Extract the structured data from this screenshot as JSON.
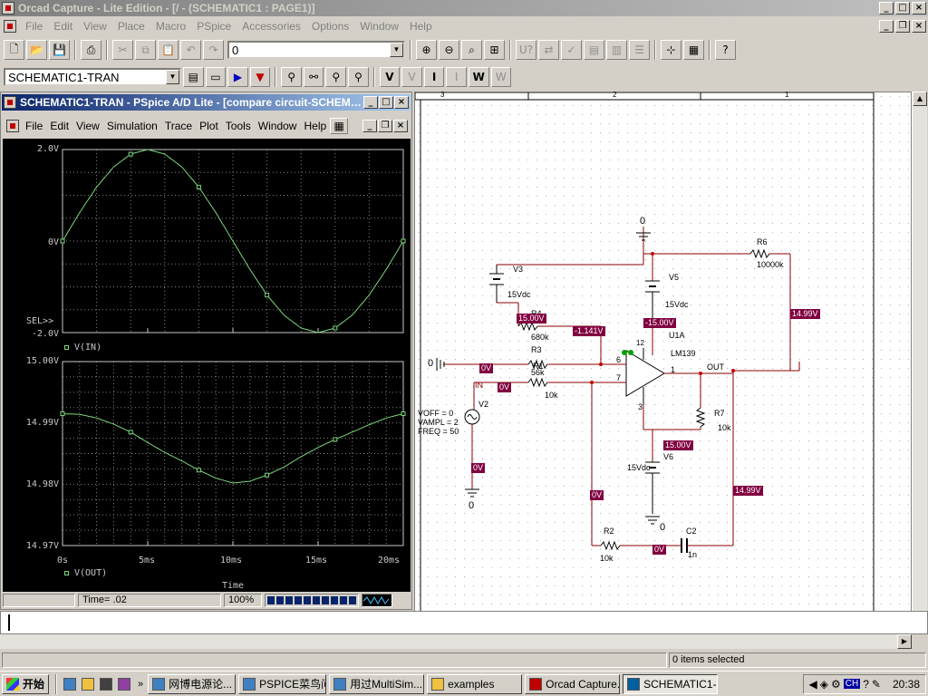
{
  "app": {
    "title": "Orcad Capture - Lite Edition - [/ - (SCHEMATIC1 : PAGE1)]",
    "menu": [
      "File",
      "Edit",
      "View",
      "Place",
      "Macro",
      "PSpice",
      "Accessories",
      "Options",
      "Window",
      "Help"
    ],
    "part_combo_value": "0",
    "profile_combo_value": "SCHEMATIC1-TRAN",
    "status_text": "0 items selected"
  },
  "pspice": {
    "title": "SCHEMATIC1-TRAN - PSpice A/D Lite - [compare circuit-SCHEMATI...",
    "menu": [
      "File",
      "Edit",
      "View",
      "Simulation",
      "Trace",
      "Plot",
      "Tools",
      "Window",
      "Help"
    ],
    "plot1": {
      "y_ticks": [
        "2.0V",
        "0V",
        "-2.0V"
      ],
      "sel_marker": "SEL>>",
      "legend": "V(IN)"
    },
    "plot2": {
      "y_ticks": [
        "15.00V",
        "14.99V",
        "14.98V",
        "14.97V"
      ],
      "legend": "V(OUT)"
    },
    "x_ticks": [
      "0s",
      "5ms",
      "10ms",
      "15ms",
      "20ms"
    ],
    "x_label": "Time",
    "status_time": "Time= .02",
    "status_percent": "100%"
  },
  "chart_data": [
    {
      "type": "line",
      "series": [
        {
          "name": "V(IN)",
          "x": [
            0,
            1,
            2,
            3,
            4,
            5,
            6,
            7,
            8,
            9,
            10,
            11,
            12,
            13,
            14,
            15,
            16,
            17,
            18,
            19,
            20
          ],
          "values": [
            0,
            0.62,
            1.18,
            1.62,
            1.9,
            2.0,
            1.9,
            1.62,
            1.18,
            0.62,
            0,
            -0.62,
            -1.18,
            -1.62,
            -1.9,
            -2.0,
            -1.9,
            -1.62,
            -1.18,
            -0.62,
            0
          ]
        }
      ],
      "x_unit": "ms",
      "ylim": [
        -2.0,
        2.0
      ],
      "grid": true
    },
    {
      "type": "line",
      "series": [
        {
          "name": "V(OUT)",
          "x": [
            0,
            1,
            2,
            3,
            4,
            5,
            6,
            7,
            8,
            9,
            10,
            11,
            12,
            13,
            14,
            15,
            16,
            17,
            18,
            19,
            20
          ],
          "values": [
            14.9915,
            14.9914,
            14.9908,
            14.9898,
            14.9885,
            14.9868,
            14.9852,
            14.9838,
            14.9823,
            14.981,
            14.9802,
            14.9805,
            14.9815,
            14.9828,
            14.9845,
            14.986,
            14.9873,
            14.9885,
            14.9897,
            14.9908,
            14.9915
          ]
        }
      ],
      "x_unit": "ms",
      "ylim": [
        14.97,
        15.0
      ],
      "grid": true
    }
  ],
  "schematic": {
    "border_cols": [
      "3",
      "2",
      "1"
    ],
    "labels": {
      "gnd_top": "0",
      "r6": "R6",
      "r6_val": "10000k",
      "v3": "V3",
      "v3_val": "15Vdc",
      "v5": "V5",
      "v5_val": "15Vdc",
      "r4": "R4",
      "r4_val": "680k",
      "u1a": "U1A",
      "lm139": "LM139",
      "r3": "R3",
      "r3_val": "56k",
      "r1": "R1",
      "r1_val": "10k",
      "out": "OUT",
      "gnd_left": "0",
      "in": "IN",
      "v2": "V2",
      "voff": "VOFF = 0",
      "vampl": "VAMPL = 2",
      "freq": "FREQ = 50",
      "r7": "R7",
      "r7_val": "10k",
      "v6": "V6",
      "v6_val": "15Vdc",
      "gnd_left_bottom": "0",
      "gnd_right_bottom": "0",
      "r2": "R2",
      "r2_val": "10k",
      "c2": "C2",
      "c2_val": "1n",
      "pin6": "6",
      "pin7": "7",
      "pin1": "1",
      "pin3": "3",
      "pin12": "12"
    },
    "voltage_tags": {
      "t1": "15.00V",
      "t2": "-1.141V",
      "t3": "-15.00V",
      "t4": "14.99V",
      "t5": "0V",
      "t6": "0V",
      "t7": "0V",
      "t8": "15.00V",
      "t9": "0V",
      "t10": "14.99V",
      "t11": "0V"
    }
  },
  "taskbar": {
    "start": "开始",
    "items": [
      "网博电源论...",
      "PSPICE菜鸟问...",
      "用过MultiSim...",
      "examples",
      "Orcad Capture...",
      "SCHEMATIC1-..."
    ],
    "lang": "CH",
    "clock": "20:38"
  }
}
